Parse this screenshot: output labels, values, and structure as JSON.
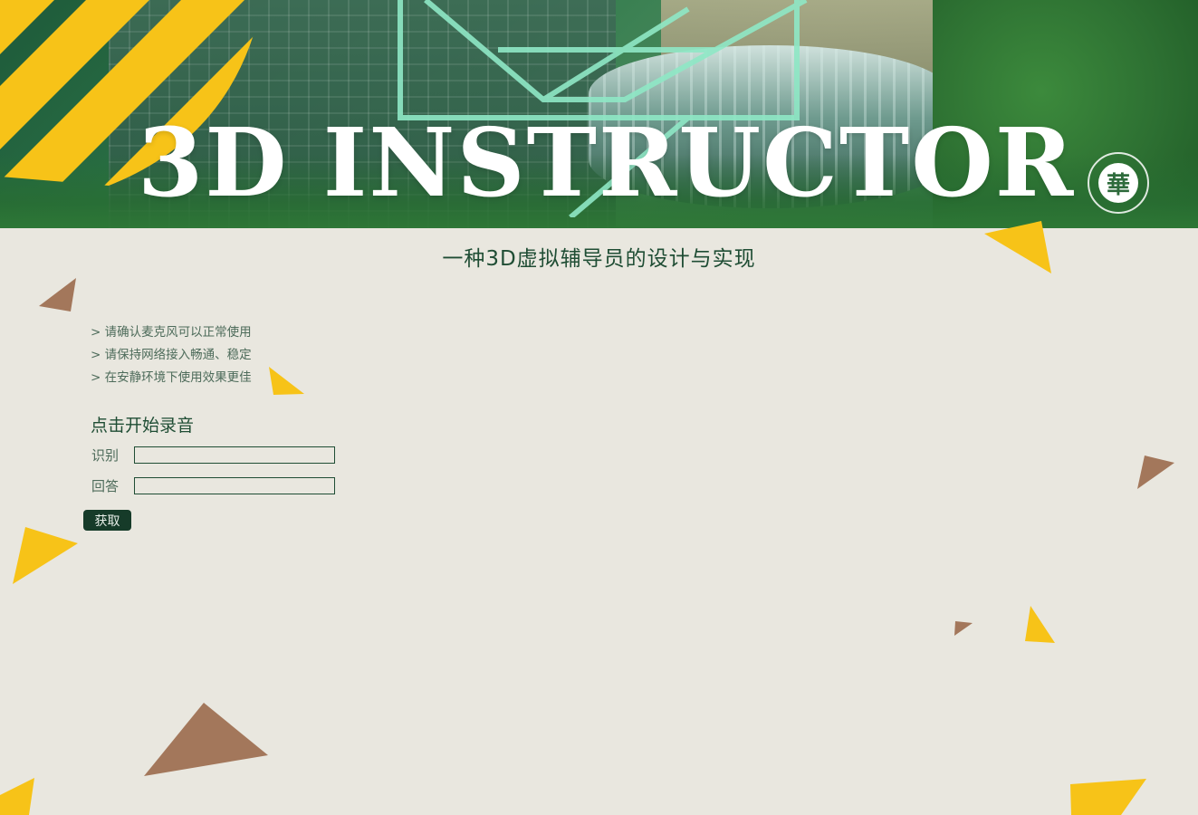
{
  "header": {
    "title": "3D INSTRUCTOR",
    "logo_icon": "university-emblem-icon"
  },
  "subtitle": "一种3D虚拟辅导员的设计与实现",
  "tips": [
    "> 请确认麦克风可以正常使用",
    "> 请保持网络接入畅通、稳定",
    "> 在安静环境下使用效果更佳"
  ],
  "record": {
    "label": "点击开始录音"
  },
  "form": {
    "recognize_label": "识别",
    "recognize_value": "",
    "answer_label": "回答",
    "answer_value": "",
    "fetch_button": "获取"
  },
  "colors": {
    "background": "#e9e7df",
    "accent_yellow": "#f7c318",
    "accent_brown": "#a3775b",
    "text_green": "#1f4d34",
    "button_bg": "#163b29"
  }
}
